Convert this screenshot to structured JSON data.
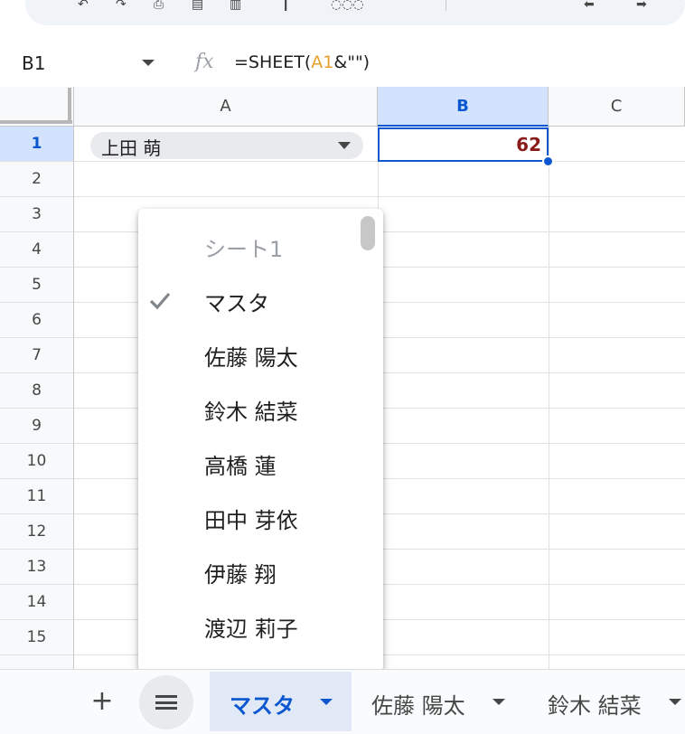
{
  "toolbar": {
    "icons": [
      "undo-icon",
      "redo-icon",
      "print-icon",
      "paint-format-icon",
      "zoom-select",
      "scroll-left-icon",
      "scroll-right-icon"
    ]
  },
  "formula_bar": {
    "name_box": "B1",
    "fx_label": "fx",
    "formula_prefix": "=SHEET(",
    "formula_ref": "A1",
    "formula_suffix": "&\"\")"
  },
  "grid": {
    "columns": [
      "A",
      "B",
      "C"
    ],
    "rows": [
      "1",
      "2",
      "3",
      "4",
      "5",
      "6",
      "7",
      "8",
      "9",
      "10",
      "11",
      "12",
      "13",
      "14",
      "15"
    ],
    "a1_chip": "上田 萌",
    "b1_value": "62"
  },
  "dropdown": {
    "items": [
      {
        "label": "シート1",
        "disabled": true
      },
      {
        "label": "マスタ",
        "checked": true
      },
      {
        "label": "佐藤 陽太"
      },
      {
        "label": "鈴木 結菜"
      },
      {
        "label": "高橋 蓮"
      },
      {
        "label": "田中 芽依"
      },
      {
        "label": "伊藤 翔"
      },
      {
        "label": "渡辺 莉子"
      }
    ]
  },
  "sheet_tabs": {
    "add_label": "+",
    "tabs": [
      {
        "label": "マスタ",
        "active": true
      },
      {
        "label": "佐藤 陽太"
      },
      {
        "label": "鈴木 結菜"
      }
    ]
  },
  "colors": {
    "selection_blue": "#0b57d0",
    "header_selected_bg": "#d3e3fd",
    "value_text": "#8b1a1a",
    "formula_ref": "#e8a02c",
    "underline_red": "#e02424"
  }
}
